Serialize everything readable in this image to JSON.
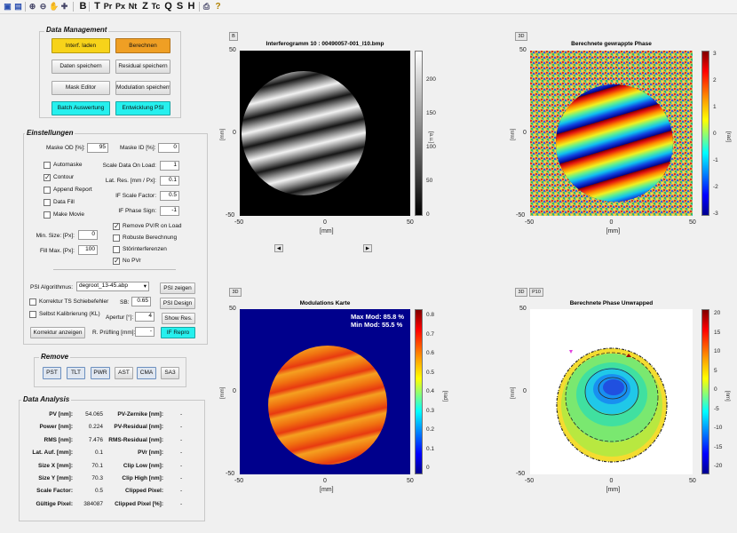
{
  "toolbar": {
    "items": [
      "B",
      "T",
      "Pr",
      "Px",
      "Nt",
      "Z",
      "Tc",
      "Q",
      "S",
      "H",
      "?"
    ]
  },
  "data_management": {
    "title": "Data Management",
    "buttons": {
      "load_interferogram": "Interf. laden",
      "calculate": "Berechnen",
      "save_data": "Daten speichern",
      "save_residual": "Residual speichern",
      "mask_editor": "Mask Editor",
      "save_modulation": "Modulation speichern",
      "batch": "Batch Auswertung",
      "psi_dev": "Entwicklung PSI"
    }
  },
  "settings": {
    "title": "Einstellungen",
    "mask_od_label": "Maske OD [%]:",
    "mask_od": "95",
    "mask_id_label": "Maske ID [%]:",
    "mask_id": "0",
    "automask": "Automaske",
    "contour": "Contour",
    "append_report": "Append Report",
    "data_fill": "Data Fill",
    "make_movie": "Make Movie",
    "scale_on_load_label": "Scale Data On Load:",
    "scale_on_load": "1",
    "lat_res_label": "Lat. Res. [mm / Px]:",
    "lat_res": "0.1",
    "if_scale_label": "IF Scale Factor:",
    "if_scale": "0.5",
    "if_phase_label": "IF Phase Sign:",
    "if_phase": "-1",
    "min_size_label": "Min. Size: [Px]:",
    "min_size": "0",
    "fill_max_label": "Fill Max. [Px]:",
    "fill_max": "100",
    "remove_pvr": "Remove PV/R on Load",
    "robust": "Robuste Berechnung",
    "stoer": "Störinterferenzen",
    "no_pvr": "No PVr",
    "psi_algo_label": "PSI Algorithmus:",
    "psi_algo": "degroot_13-45.abp",
    "psi_show": "PSI zeigen",
    "korrektur_ts": "Korrektur TS Schiebefehler",
    "sb_label": "SB:",
    "sb": "0.65",
    "psi_design": "PSI Design",
    "selbst_kal": "Selbst Kalibrierung (KL)",
    "apertur_label": "Apertur [°]:",
    "apertur": "4",
    "show_res": "Show Res.",
    "korrektur_anzeigen": "Korrektur anzeigen",
    "r_pruefling_label": "R. Prüfling [mm]:",
    "r_pruefling": "-",
    "if_repro": "IF Repro"
  },
  "remove": {
    "title": "Remove",
    "buttons": [
      "PST",
      "TLT",
      "PWR",
      "AST",
      "CMA",
      "SA3"
    ]
  },
  "analysis": {
    "title": "Data Analysis",
    "left": [
      {
        "label": "PV [nm]:",
        "value": "54.065"
      },
      {
        "label": "Power [nm]:",
        "value": "0.224"
      },
      {
        "label": "RMS [nm]:",
        "value": "7.476"
      },
      {
        "label": "Lat. Auf. [mm]:",
        "value": "0.1"
      },
      {
        "label": "Size X [mm]:",
        "value": "70.1"
      },
      {
        "label": "Size Y [mm]:",
        "value": "70.3"
      },
      {
        "label": "Scale Factor:",
        "value": "0.5"
      },
      {
        "label": "Gültige Pixel:",
        "value": "384087"
      }
    ],
    "right": [
      {
        "label": "PV-Zernike [nm]:",
        "value": "-"
      },
      {
        "label": "PV-Residual [nm]:",
        "value": "-"
      },
      {
        "label": "RMS-Residual [nm]:",
        "value": "-"
      },
      {
        "label": "PVr [nm]:",
        "value": "-"
      },
      {
        "label": "Clip Low [nm]:",
        "value": "-"
      },
      {
        "label": "Clip High [nm]:",
        "value": "-"
      },
      {
        "label": "Clipped Pixel:",
        "value": "-"
      },
      {
        "label": "Clipped Pixel [%]:",
        "value": "-"
      }
    ]
  },
  "plots": {
    "p1": {
      "tag": "B",
      "title": "Interferogramm 10 : 00490057-001_I10.bmp",
      "cb_label": "[a.u.]",
      "cb_ticks": [
        "200",
        "150",
        "100",
        "50",
        "0"
      ]
    },
    "p2": {
      "tag": "3D",
      "title": "Berechnete gewrappte Phase",
      "cb_label": "[rad]",
      "cb_ticks": [
        "3",
        "2",
        "1",
        "0",
        "-1",
        "-2",
        "-3"
      ]
    },
    "p3": {
      "tag": "3D",
      "title": "Modulations Karte",
      "cb_label": "[rad]",
      "cb_ticks": [
        "0.8",
        "0.7",
        "0.6",
        "0.5",
        "0.4",
        "0.3",
        "0.2",
        "0.1",
        "0"
      ],
      "max_mod": "Max Mod: 85.8 %",
      "min_mod": "Min Mod: 55.5 %"
    },
    "p4": {
      "tag": "3D",
      "tag2": "P10",
      "title": "Berechnete Phase Unwrapped",
      "cb_label": "[nm]",
      "cb_ticks": [
        "20",
        "15",
        "10",
        "5",
        "0",
        "-5",
        "-10",
        "-15",
        "-20"
      ]
    },
    "axis": {
      "x_ticks": [
        "-50",
        "0",
        "50"
      ],
      "y_ticks": [
        "50",
        "0",
        "-50"
      ],
      "unit": "[mm]"
    }
  }
}
